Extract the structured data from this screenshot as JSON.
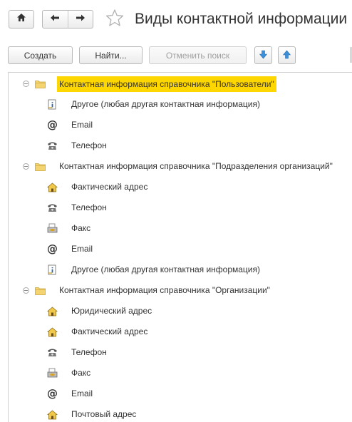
{
  "header": {
    "title": "Виды контактной информации",
    "icons": {
      "home": "home-icon",
      "back": "arrow-left-icon",
      "forward": "arrow-right-icon",
      "favorite": "star-icon"
    }
  },
  "toolbar": {
    "create_label": "Создать",
    "find_label": "Найти...",
    "cancel_search_label": "Отменить поиск",
    "move_down_icon": "arrow-down-icon",
    "move_up_icon": "arrow-up-icon"
  },
  "colors": {
    "highlight": "#ffd700",
    "accent_blue": "#3c8fd9",
    "text": "#333333"
  },
  "groups": [
    {
      "label": "Контактная информация справочника \"Пользователи\"",
      "selected": true,
      "items": [
        {
          "label": "Другое (любая другая контактная информация)",
          "icon": "note-icon"
        },
        {
          "label": "Email",
          "icon": "at-icon"
        },
        {
          "label": "Телефон",
          "icon": "phone-icon"
        }
      ]
    },
    {
      "label": "Контактная информация справочника \"Подразделения организаций\"",
      "selected": false,
      "items": [
        {
          "label": "Фактический адрес",
          "icon": "house-icon"
        },
        {
          "label": "Телефон",
          "icon": "phone-icon"
        },
        {
          "label": "Факс",
          "icon": "fax-icon"
        },
        {
          "label": "Email",
          "icon": "at-icon"
        },
        {
          "label": "Другое (любая другая контактная информация)",
          "icon": "note-icon"
        }
      ]
    },
    {
      "label": "Контактная информация справочника \"Организации\"",
      "selected": false,
      "items": [
        {
          "label": "Юридический адрес",
          "icon": "house-icon"
        },
        {
          "label": "Фактический адрес",
          "icon": "house-icon"
        },
        {
          "label": "Телефон",
          "icon": "phone-icon"
        },
        {
          "label": "Факс",
          "icon": "fax-icon"
        },
        {
          "label": "Email",
          "icon": "at-icon"
        },
        {
          "label": "Почтовый адрес",
          "icon": "house-icon"
        }
      ]
    }
  ]
}
